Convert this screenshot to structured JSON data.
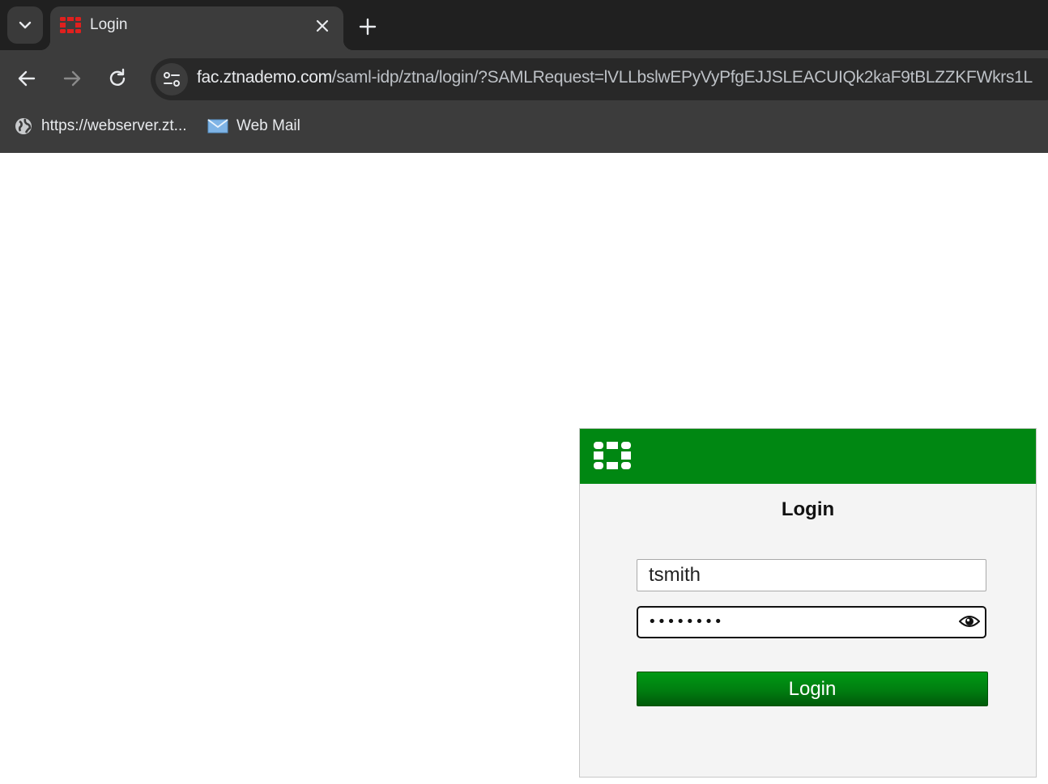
{
  "browser": {
    "tab": {
      "title": "Login",
      "favicon": "fortinet-grid-icon"
    },
    "url": {
      "host": "fac.ztnademo.com",
      "path": "/saml-idp/ztna/login/?SAMLRequest=lVLLbslwEPyVyPfgEJJSLEACUIQk2kaF9tBLZZKFWkrs1L"
    },
    "bookmarks": [
      {
        "label": "https://webserver.zt...",
        "icon": "globe-icon"
      },
      {
        "label": "Web Mail",
        "icon": "mail-icon"
      }
    ]
  },
  "login": {
    "heading": "Login",
    "username_value": "tsmith",
    "password_mask": "••••••••",
    "submit_label": "Login",
    "brand_color": "#008712"
  }
}
